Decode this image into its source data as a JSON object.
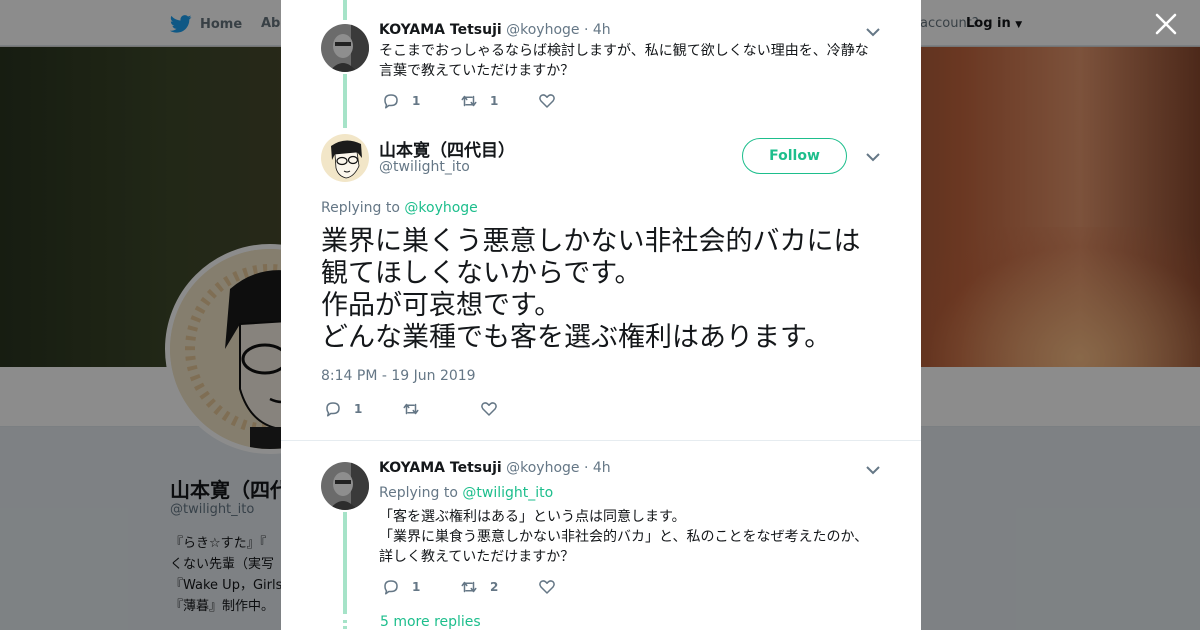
{
  "nav": {
    "home_label": "Home",
    "about_label": "Abo",
    "account_text": "account?",
    "login_label": "Log in"
  },
  "profile": {
    "name": "山本寛（四代目）",
    "handle": "@twilight_ito",
    "bio_lines": [
      "『らき☆すた』『",
      "くない先輩（実写",
      "『Wake Up，Girls",
      "『薄暮』制作中。"
    ]
  },
  "thread": {
    "reply1": {
      "name": "KOYAMA Tetsuji",
      "handle": "@koyhoge",
      "time": "· 4h",
      "text_lines": [
        "そこまでおっしゃるならば検討しますが、私に観て欲しくない理由を、冷静な",
        "言葉で教えていただけますか？"
      ],
      "reply_count": "1",
      "retweet_count": "1",
      "like_count": ""
    },
    "main": {
      "name": "山本寛（四代目）",
      "handle": "@twilight_ito",
      "follow_label": "Follow",
      "replying_prefix": "Replying to",
      "replying_to": "@koyhoge",
      "text_lines": [
        "業界に巣くう悪意しかない非社会的バカには",
        "観てほしくないからです。",
        "作品が可哀想です。",
        "どんな業種でも客を選ぶ権利はあります。"
      ],
      "timestamp": "8:14 PM - 19 Jun 2019",
      "reply_count": "1",
      "retweet_count": "",
      "like_count": ""
    },
    "reply2": {
      "name": "KOYAMA Tetsuji",
      "handle": "@koyhoge",
      "time": "· 4h",
      "replying_prefix": "Replying to",
      "replying_to": "@twilight_ito",
      "text_lines": [
        "「客を選ぶ権利はある」という点は同意します。",
        "「業界に巣食う悪意しかない非社会的バカ」と、私のことをなぜ考えたのか、",
        "詳しく教えていただけますか？"
      ],
      "reply_count": "1",
      "retweet_count": "2",
      "like_count": ""
    },
    "more_replies": "5 more replies"
  },
  "colors": {
    "accent": "#1dbe8c",
    "thread_line": "#a6e3c8",
    "muted": "#657786",
    "twitter_blue": "#1da1f2"
  }
}
